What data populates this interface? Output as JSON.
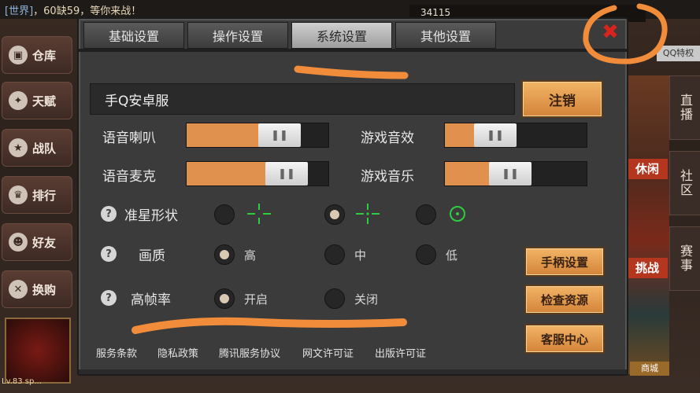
{
  "background": {
    "chat": {
      "tag": "[世界]",
      "text": "，60缺59，等你来战！"
    },
    "top_right_value": "34115",
    "left_nav": [
      {
        "icon": "box-icon",
        "label": "仓库"
      },
      {
        "icon": "talent-icon",
        "label": "天赋"
      },
      {
        "icon": "team-icon",
        "label": "战队"
      },
      {
        "icon": "trophy-icon",
        "label": "排行"
      },
      {
        "icon": "friends-icon",
        "label": "好友"
      },
      {
        "icon": "tools-icon",
        "label": "换购"
      }
    ],
    "right_nav": [
      "直播",
      "社区",
      "赛事"
    ],
    "right_art_labels": [
      "休闲",
      "挑战"
    ],
    "qq_tag": "QQ特权",
    "mall_label": "商城",
    "player_level": "Lv.83 sp..."
  },
  "dialog": {
    "tabs": [
      {
        "label": "基础设置",
        "active": false
      },
      {
        "label": "操作设置",
        "active": false
      },
      {
        "label": "系统设置",
        "active": true
      },
      {
        "label": "其他设置",
        "active": false
      }
    ],
    "server_name": "手Q安卓服",
    "logout_button": "注销",
    "sliders": {
      "voice_speaker": {
        "label": "语音喇叭",
        "value": 0.55
      },
      "game_sound": {
        "label": "游戏音效",
        "value": 0.33
      },
      "voice_mic": {
        "label": "语音麦克",
        "value": 0.6
      },
      "game_music": {
        "label": "游戏音乐",
        "value": 0.46
      }
    },
    "crosshair": {
      "label": "准星形状",
      "selected": 1,
      "options": [
        "cross-open",
        "cross-dot",
        "circle-dot"
      ]
    },
    "quality": {
      "label": "画质",
      "selected": 0,
      "options": [
        "高",
        "中",
        "低"
      ]
    },
    "high_fps": {
      "label": "高帧率",
      "selected": 0,
      "options": [
        "开启",
        "关闭"
      ]
    },
    "side_buttons": [
      "手柄设置",
      "检查资源",
      "客服中心"
    ],
    "footer_links": [
      "服务条款",
      "隐私政策",
      "腾讯服务协议",
      "网文许可证",
      "出版许可证"
    ],
    "close_icon": "close-icon",
    "colors": {
      "accent": "#e0914e",
      "crosshair": "#2ecc40",
      "close": "#d8241c",
      "annotation": "#f08c3a"
    }
  }
}
